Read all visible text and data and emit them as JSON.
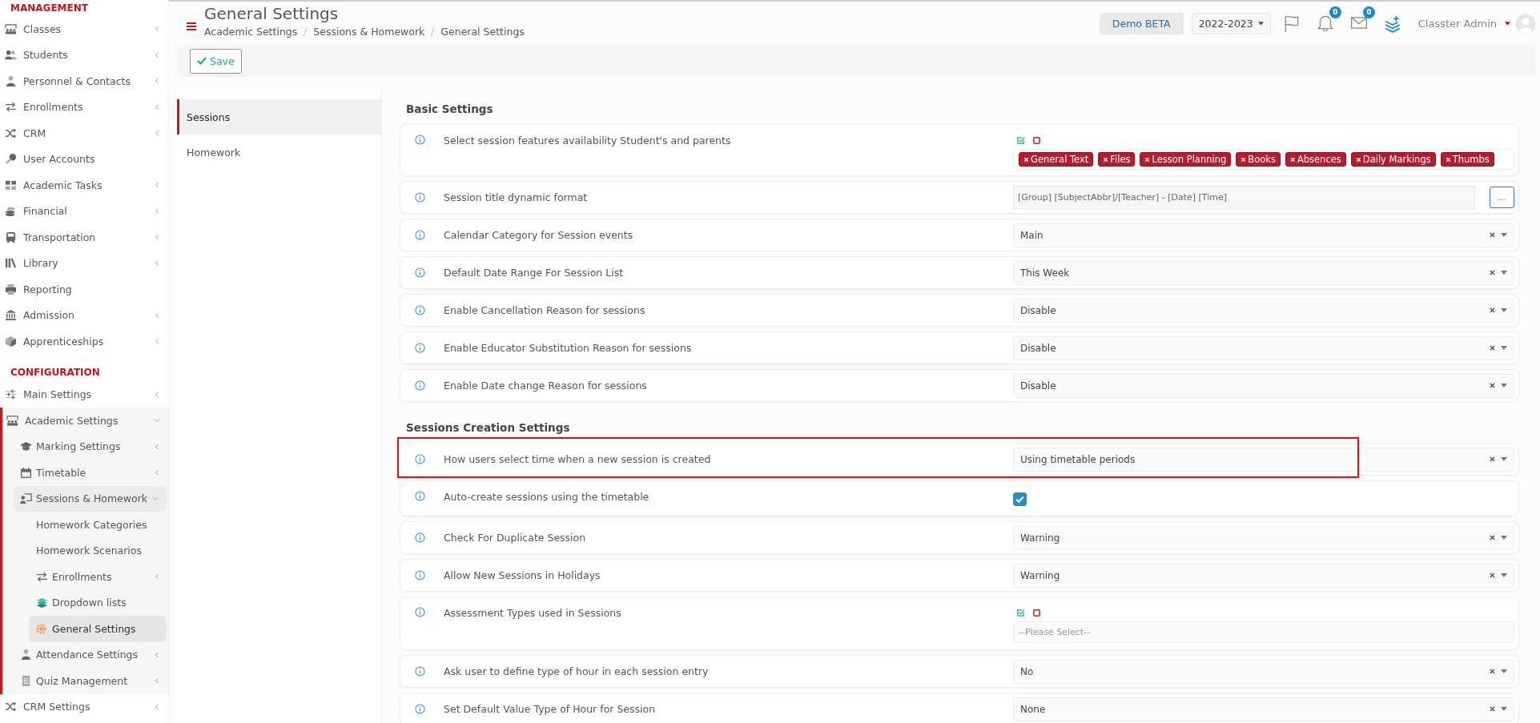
{
  "sidebar": {
    "sections": [
      {
        "heading": "MANAGEMENT",
        "items": [
          {
            "label": "Classes",
            "kind": "group",
            "expanded": false,
            "selected": false
          },
          {
            "label": "Students",
            "kind": "group",
            "expanded": false,
            "selected": false
          },
          {
            "label": "Personnel & Contacts",
            "kind": "group",
            "expanded": false,
            "selected": false
          },
          {
            "label": "Enrollments",
            "kind": "group",
            "expanded": false,
            "selected": false
          },
          {
            "label": "CRM",
            "kind": "group",
            "expanded": false,
            "selected": false
          },
          {
            "label": "User Accounts",
            "kind": "link",
            "selected": false
          },
          {
            "label": "Academic Tasks",
            "kind": "group",
            "expanded": false,
            "selected": false
          },
          {
            "label": "Financial",
            "kind": "group",
            "expanded": false,
            "selected": false
          },
          {
            "label": "Transportation",
            "kind": "group",
            "expanded": false,
            "selected": false
          },
          {
            "label": "Library",
            "kind": "group",
            "expanded": false,
            "selected": false
          },
          {
            "label": "Reporting",
            "kind": "link",
            "selected": false
          },
          {
            "label": "Admission",
            "kind": "group",
            "expanded": false,
            "selected": false
          },
          {
            "label": "Apprenticeships",
            "kind": "group",
            "expanded": false,
            "selected": false
          }
        ]
      },
      {
        "heading": "CONFIGURATION",
        "items": [
          {
            "label": "Main Settings",
            "kind": "group",
            "expanded": false,
            "selected": false
          },
          {
            "label": "Academic Settings",
            "kind": "group",
            "expanded": true,
            "selected": false,
            "children": [
              {
                "label": "Marking Settings",
                "kind": "group",
                "expanded": false,
                "selected": false
              },
              {
                "label": "Timetable",
                "kind": "group",
                "expanded": false,
                "selected": false
              },
              {
                "label": "Sessions & Homework",
                "kind": "group",
                "expanded": true,
                "selected": false,
                "children": [
                  {
                    "label": "Homework Categories",
                    "kind": "link",
                    "selected": false
                  },
                  {
                    "label": "Homework Scenarios",
                    "kind": "link",
                    "selected": false
                  },
                  {
                    "label": "Enrollments",
                    "kind": "group",
                    "expanded": false,
                    "selected": false
                  },
                  {
                    "label": "Dropdown lists",
                    "kind": "link",
                    "selected": false
                  },
                  {
                    "label": "General Settings",
                    "kind": "link",
                    "selected": true
                  }
                ]
              },
              {
                "label": "Attendance Settings",
                "kind": "group",
                "expanded": false,
                "selected": false
              },
              {
                "label": "Quiz Management",
                "kind": "group",
                "expanded": false,
                "selected": false
              }
            ]
          },
          {
            "label": "CRM Settings",
            "kind": "group",
            "expanded": false,
            "selected": false
          }
        ]
      }
    ]
  },
  "header": {
    "title": "General Settings",
    "breadcrumb": [
      "Academic Settings",
      "Sessions & Homework",
      "General Settings"
    ],
    "demo_label": "Demo BETA",
    "year": "2022-2023",
    "notifications": "0",
    "messages": "0",
    "user": "Classter Admin"
  },
  "toolbar": {
    "save": "Save"
  },
  "tabs": [
    {
      "label": "Sessions",
      "selected": true
    },
    {
      "label": "Homework",
      "selected": false
    }
  ],
  "sections": [
    {
      "title": "Basic Settings",
      "rows": [
        {
          "label": "Select session features availability Student's and parents",
          "kind": "tags",
          "highlighted": false,
          "tags": [
            "General Text",
            "Files",
            "Lesson Planning",
            "Books",
            "Absences",
            "Daily Markings",
            "Thumbs"
          ]
        },
        {
          "label": "Session title dynamic format",
          "kind": "text",
          "highlighted": false,
          "value": "[Group] [SubjectAbbr]/[Teacher] - [Date] [Time]",
          "button": "..."
        },
        {
          "label": "Calendar Category for Session events",
          "kind": "select",
          "highlighted": false,
          "value": "Main"
        },
        {
          "label": "Default Date Range For Session List",
          "kind": "select",
          "highlighted": false,
          "value": "This Week"
        },
        {
          "label": "Enable Cancellation Reason for sessions",
          "kind": "select",
          "highlighted": false,
          "value": "Disable"
        },
        {
          "label": "Enable Educator Substitution Reason for sessions",
          "kind": "select",
          "highlighted": false,
          "value": "Disable"
        },
        {
          "label": "Enable Date change Reason for sessions",
          "kind": "select",
          "highlighted": false,
          "value": "Disable"
        }
      ]
    },
    {
      "title": "Sessions Creation Settings",
      "rows": [
        {
          "label": "How users select time when a new session is created",
          "kind": "select",
          "highlighted": true,
          "value": "Using timetable periods"
        },
        {
          "label": "Auto-create sessions using the timetable",
          "kind": "checkbox",
          "highlighted": false,
          "checked": true
        },
        {
          "label": "Check For Duplicate Session",
          "kind": "select",
          "highlighted": false,
          "value": "Warning"
        },
        {
          "label": "Allow New Sessions in Holidays",
          "kind": "select",
          "highlighted": false,
          "value": "Warning"
        },
        {
          "label": "Assessment Types used in Sessions",
          "kind": "multiselect",
          "highlighted": false,
          "placeholder": "--Please Select--"
        },
        {
          "label": "Ask user to define type of hour in each session entry",
          "kind": "select",
          "highlighted": false,
          "value": "No"
        },
        {
          "label": "Set Default Value Type of Hour for Session",
          "kind": "select",
          "highlighted": false,
          "value": "None"
        }
      ]
    }
  ]
}
